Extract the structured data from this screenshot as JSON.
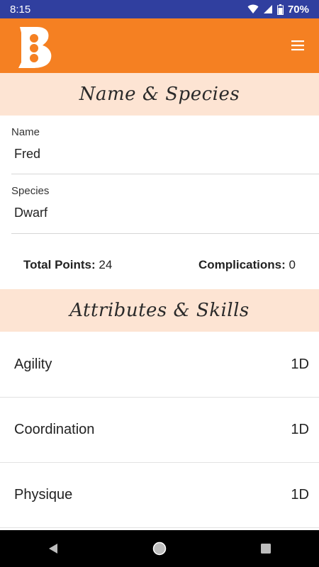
{
  "status_bar": {
    "time": "8:15",
    "battery": "70%"
  },
  "app_bar": {
    "logo_letter": "B"
  },
  "sections": {
    "name_species": "Name & Species",
    "attributes_skills": "Attributes & Skills"
  },
  "fields": {
    "name": {
      "label": "Name",
      "value": "Fred"
    },
    "species": {
      "label": "Species",
      "value": "Dwarf"
    }
  },
  "totals": {
    "total_points_label": "Total Points:",
    "total_points_value": "24",
    "complications_label": "Complications:",
    "complications_value": "0"
  },
  "attributes": [
    {
      "name": "Agility",
      "value": "1D"
    },
    {
      "name": "Coordination",
      "value": "1D"
    },
    {
      "name": "Physique",
      "value": "1D"
    }
  ],
  "colors": {
    "status": "#303f9f",
    "accent": "#f58022",
    "header_bg": "#fde4d3"
  },
  "icons": [
    "wifi-icon",
    "signal-icon",
    "battery-icon",
    "menu-icon",
    "back-icon",
    "home-icon",
    "recents-icon"
  ]
}
